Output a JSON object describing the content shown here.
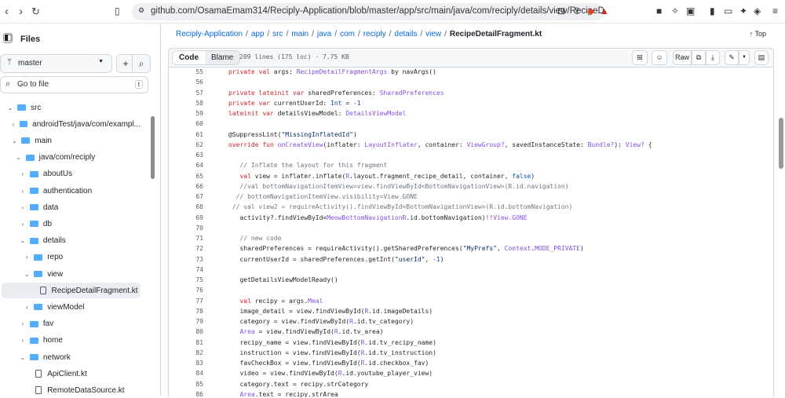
{
  "browser": {
    "url": "github.com/OsamaEmam314/Reciply-Application/blob/master/app/src/main/java/com/reciply/details/view/RecipeD..."
  },
  "sidebar": {
    "title": "Files",
    "branch": "master",
    "goto_placeholder": "Go to file",
    "goto_key": "t",
    "tree": [
      {
        "label": "src",
        "type": "folder",
        "open": true,
        "level": 0
      },
      {
        "label": "androidTest/java/com/exampl...",
        "type": "folder",
        "open": false,
        "level": 1
      },
      {
        "label": "main",
        "type": "folder",
        "open": true,
        "level": 1
      },
      {
        "label": "java/com/reciply",
        "type": "folder",
        "open": true,
        "level": 2
      },
      {
        "label": "aboutUs",
        "type": "folder",
        "open": false,
        "level": 3
      },
      {
        "label": "authentication",
        "type": "folder",
        "open": false,
        "level": 3
      },
      {
        "label": "data",
        "type": "folder",
        "open": false,
        "level": 3
      },
      {
        "label": "db",
        "type": "folder",
        "open": false,
        "level": 3
      },
      {
        "label": "details",
        "type": "folder",
        "open": true,
        "level": 3
      },
      {
        "label": "repo",
        "type": "folder",
        "open": false,
        "level": 4
      },
      {
        "label": "view",
        "type": "folder",
        "open": true,
        "level": 4
      },
      {
        "label": "RecipeDetailFragment.kt",
        "type": "file",
        "level": 5,
        "selected": true
      },
      {
        "label": "viewModel",
        "type": "folder",
        "open": false,
        "level": 4
      },
      {
        "label": "fav",
        "type": "folder",
        "open": false,
        "level": 3
      },
      {
        "label": "home",
        "type": "folder",
        "open": false,
        "level": 3
      },
      {
        "label": "network",
        "type": "folder",
        "open": true,
        "level": 3
      },
      {
        "label": "ApiClient.kt",
        "type": "file",
        "level": 4
      },
      {
        "label": "RemoteDataSource.kt",
        "type": "file",
        "level": 4
      }
    ]
  },
  "breadcrumb": [
    "Reciply-Application",
    "app",
    "src",
    "main",
    "java",
    "com",
    "reciply",
    "details",
    "view"
  ],
  "current_file": "RecipeDetailFragment.kt",
  "top_link": "↑ Top",
  "code_header": {
    "code_tab": "Code",
    "blame_tab": "Blame",
    "meta": "209 lines (175 loc) · 7.75 KB",
    "raw": "Raw"
  },
  "code": [
    {
      "n": 55,
      "t": [
        [
          "k",
          "private val "
        ],
        [
          "",
          "args: "
        ],
        [
          "t",
          "RecipeDetailFragmentArgs"
        ],
        [
          "",
          " by navArgs()"
        ]
      ]
    },
    {
      "n": 56,
      "t": []
    },
    {
      "n": 57,
      "t": [
        [
          "k",
          "private lateinit var "
        ],
        [
          "",
          "sharedPreferences: "
        ],
        [
          "t",
          "SharedPreferences"
        ]
      ]
    },
    {
      "n": 58,
      "t": [
        [
          "k",
          "private var "
        ],
        [
          "",
          "currentUserId: "
        ],
        [
          "n",
          "Int"
        ],
        [
          "",
          " = "
        ],
        [
          "n",
          "-1"
        ]
      ]
    },
    {
      "n": 59,
      "t": [
        [
          "k",
          "lateinit var "
        ],
        [
          "",
          "detailsViewModel: "
        ],
        [
          "t",
          "DetailsViewModel"
        ]
      ]
    },
    {
      "n": 60,
      "t": []
    },
    {
      "n": 61,
      "t": [
        [
          "",
          "@SuppressLint("
        ],
        [
          "s",
          "\"MissingInflatedId\""
        ],
        [
          "",
          ")"
        ]
      ]
    },
    {
      "n": 62,
      "t": [
        [
          "k",
          "override fun "
        ],
        [
          "t",
          "onCreateView"
        ],
        [
          "",
          "(inflater: "
        ],
        [
          "t",
          "LayoutInflater"
        ],
        [
          "",
          ", container: "
        ],
        [
          "t",
          "ViewGroup?"
        ],
        [
          "",
          ", savedInstanceState: "
        ],
        [
          "t",
          "Bundle?"
        ],
        [
          "",
          "): "
        ],
        [
          "t",
          "View?"
        ],
        [
          "",
          " {"
        ]
      ]
    },
    {
      "n": 63,
      "t": []
    },
    {
      "n": 64,
      "t": [
        [
          "c",
          "   // Inflate the layout for this fragment"
        ]
      ]
    },
    {
      "n": 65,
      "t": [
        [
          "k",
          "   val "
        ],
        [
          "",
          "view = inflater.inflate("
        ],
        [
          "t",
          "R"
        ],
        [
          "",
          ".layout.fragment_recipe_detail, container, "
        ],
        [
          "n",
          "false"
        ],
        [
          "",
          ")"
        ]
      ]
    },
    {
      "n": 66,
      "t": [
        [
          "c",
          "   //val bottomNavigationItemView=view.findViewById<BottomNavigationView>(R.id.navigation)"
        ]
      ]
    },
    {
      "n": 67,
      "t": [
        [
          "c",
          "  // bottomNavigationItemView.visibility=View.GONE"
        ]
      ]
    },
    {
      "n": 68,
      "t": [
        [
          "c",
          " // val view2 = requireActivity().findViewById<BottomNavigationView>(R.id.bottomNavigation)"
        ]
      ]
    },
    {
      "n": 69,
      "t": [
        [
          "",
          "   activity?.findViewById<"
        ],
        [
          "t",
          "MeowBottomNavigation"
        ],
        [
          ">("
        ],
        [
          "t",
          "R"
        ],
        [
          "",
          ".id.bottomNavigation)"
        ],
        [
          "k",
          "!!"
        ],
        [
          ".visibility="
        ],
        [
          "t",
          "View.GONE"
        ]
      ]
    },
    {
      "n": 70,
      "t": []
    },
    {
      "n": 71,
      "t": [
        [
          "c",
          "   // new code"
        ]
      ]
    },
    {
      "n": 72,
      "t": [
        [
          "",
          "   sharedPreferences = requireActivity().getSharedPreferences("
        ],
        [
          "s",
          "\"MyPrefs\""
        ],
        [
          "",
          ", "
        ],
        [
          "t",
          "Context"
        ],
        [
          "",
          "."
        ],
        [
          "t",
          "MODE_PRIVATE"
        ],
        [
          "",
          ")"
        ]
      ]
    },
    {
      "n": 73,
      "t": [
        [
          "",
          "   currentUserId = sharedPreferences.getInt("
        ],
        [
          "s",
          "\"userId\""
        ],
        [
          "",
          ", "
        ],
        [
          "n",
          "-1"
        ],
        [
          "",
          ")"
        ]
      ]
    },
    {
      "n": 74,
      "t": []
    },
    {
      "n": 75,
      "t": [
        [
          "",
          "   getDetailsViewModelReady()"
        ]
      ]
    },
    {
      "n": 76,
      "t": []
    },
    {
      "n": 77,
      "t": [
        [
          "k",
          "   val "
        ],
        [
          "",
          "recipy = args."
        ],
        [
          "t",
          "Meal"
        ]
      ]
    },
    {
      "n": 78,
      "t": [
        [
          "",
          "   image_detail = view.findViewById("
        ],
        [
          "t",
          "R"
        ],
        [
          "",
          ".id.imageDetails)"
        ]
      ]
    },
    {
      "n": 79,
      "t": [
        [
          "",
          "   category = view.findViewById("
        ],
        [
          "t",
          "R"
        ],
        [
          "",
          ".id.tv_category)"
        ]
      ]
    },
    {
      "n": 80,
      "t": [
        [
          "t",
          "   Area"
        ],
        [
          "",
          " = view.findViewById("
        ],
        [
          "t",
          "R"
        ],
        [
          "",
          ".id.tv_area)"
        ]
      ]
    },
    {
      "n": 81,
      "t": [
        [
          "",
          "   recipy_name = view.findViewById("
        ],
        [
          "t",
          "R"
        ],
        [
          "",
          ".id.tv_recipy_name)"
        ]
      ]
    },
    {
      "n": 82,
      "t": [
        [
          "",
          "   instruction = view.findViewById("
        ],
        [
          "t",
          "R"
        ],
        [
          "",
          ".id.tv_instruction)"
        ]
      ]
    },
    {
      "n": 83,
      "t": [
        [
          "",
          "   favCheckBox = view.findViewById("
        ],
        [
          "t",
          "R"
        ],
        [
          "",
          ".id.checkbox_fav)"
        ]
      ]
    },
    {
      "n": 84,
      "t": [
        [
          "",
          "   video = view.findViewById("
        ],
        [
          "t",
          "R"
        ],
        [
          "",
          ".id.youtube_player_view)"
        ]
      ]
    },
    {
      "n": 85,
      "t": [
        [
          "",
          "   category.text = recipy.strCategory"
        ]
      ]
    },
    {
      "n": 86,
      "t": [
        [
          "t",
          "   Area"
        ],
        [
          "",
          ".text = recipy.strArea"
        ]
      ]
    }
  ],
  "colors": {
    "link": "#0969da",
    "folder": "#54aeff",
    "keyword": "#cf222e",
    "type": "#8250df"
  }
}
